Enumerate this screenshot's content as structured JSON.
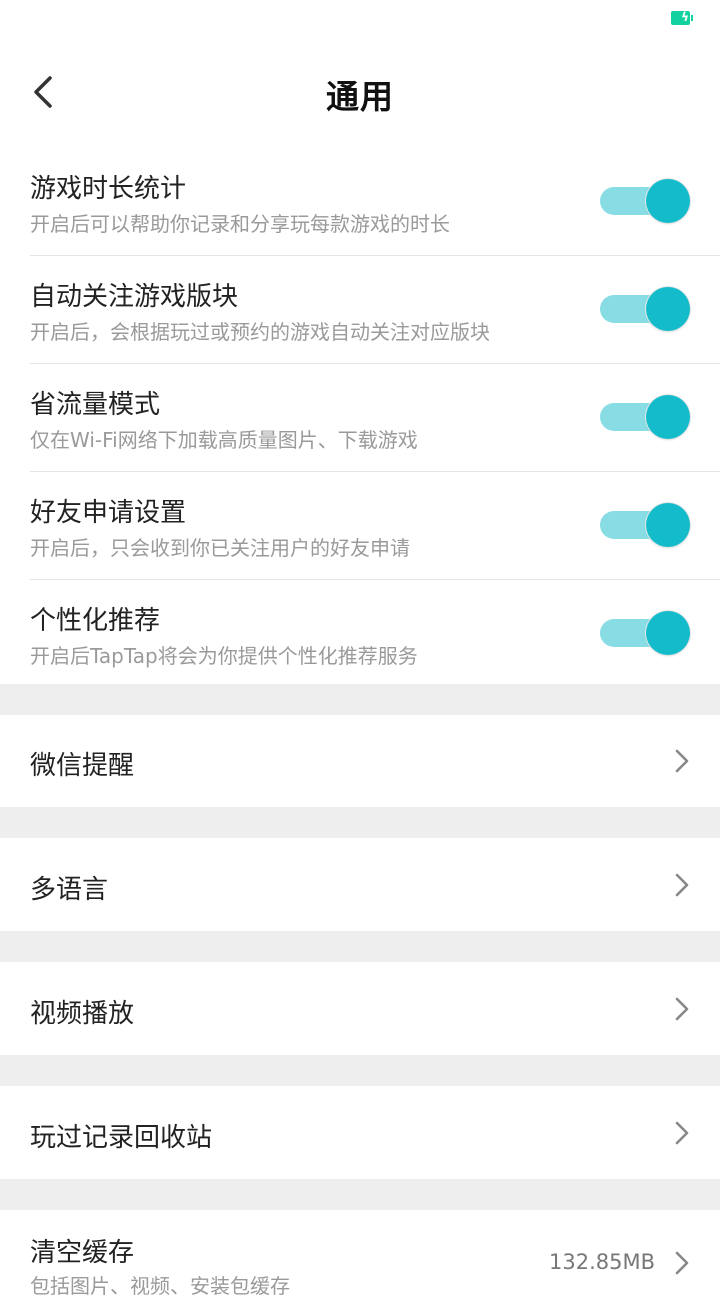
{
  "status_bar": {
    "battery_color": "#13d2a0",
    "battery_icon": "battery-charging-icon"
  },
  "header": {
    "title": "通用",
    "back_icon": "chevron-left-icon"
  },
  "colors": {
    "accent": "#14bccb",
    "track": "#88dde4",
    "section_gap": "#eeeeee"
  },
  "toggles": [
    {
      "title": "游戏时长统计",
      "description": "开启后可以帮助你记录和分享玩每款游戏的时长",
      "on": true
    },
    {
      "title": "自动关注游戏版块",
      "description": "开启后，会根据玩过或预约的游戏自动关注对应版块",
      "on": true
    },
    {
      "title": "省流量模式",
      "description": "仅在Wi-Fi网络下加载高质量图片、下载游戏",
      "on": true
    },
    {
      "title": "好友申请设置",
      "description": "开启后，只会收到你已关注用户的好友申请",
      "on": true
    },
    {
      "title": "个性化推荐",
      "description": "开启后TapTap将会为你提供个性化推荐服务",
      "on": true
    }
  ],
  "nav_items": [
    {
      "label": "微信提醒"
    },
    {
      "label": "多语言"
    },
    {
      "label": "视频播放"
    },
    {
      "label": "玩过记录回收站"
    }
  ],
  "cache": {
    "label": "清空缓存",
    "value": "132.85MB",
    "description": "包括图片、视频、安装包缓存"
  }
}
